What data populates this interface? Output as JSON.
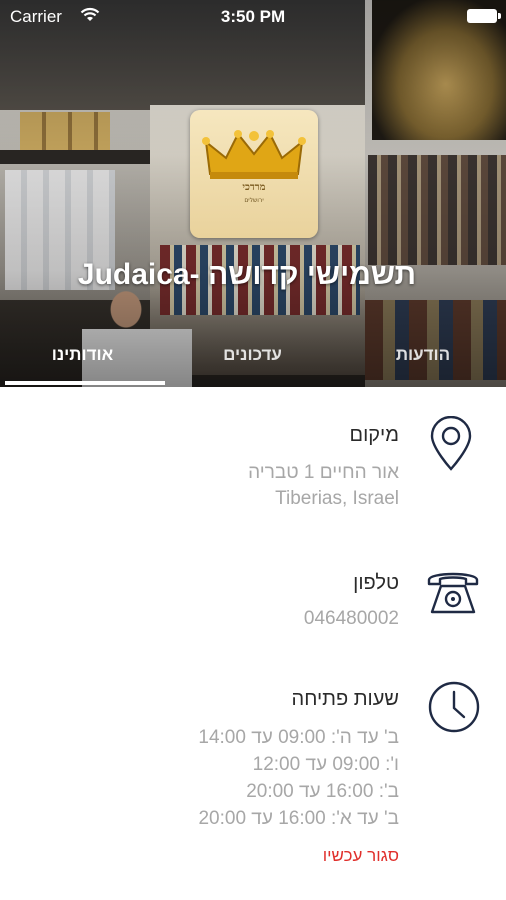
{
  "status_bar": {
    "carrier": "Carrier",
    "time": "3:50 PM"
  },
  "header": {
    "business_name": "תשמישי קדושה -Judaica",
    "logo_text": "מרדכי",
    "logo_subtext": "ירושלים"
  },
  "tabs": [
    {
      "label": "אודותינו",
      "active": true
    },
    {
      "label": "עדכונים",
      "active": false
    },
    {
      "label": "הודעות",
      "active": false
    }
  ],
  "location": {
    "heading": "מיקום",
    "line1": "אור החיים 1 טבריה",
    "line2": "Tiberias, Israel"
  },
  "phone": {
    "heading": "טלפון",
    "number": "046480002"
  },
  "hours": {
    "heading": "שעות פתיחה",
    "rows": [
      "ב' עד ה': 09:00 עד 14:00",
      "ו': 09:00 עד 12:00",
      "ב': 16:00 עד 20:00",
      "ב' עד א': 16:00 עד 20:00"
    ],
    "status": "סגור עכשיו"
  },
  "colors": {
    "icon_navy": "#1f2a44",
    "closed_red": "#e0302c",
    "muted_text": "#a7a7a7"
  },
  "icons": [
    "wifi-icon",
    "battery-icon",
    "map-pin-icon",
    "telephone-icon",
    "clock-icon"
  ]
}
